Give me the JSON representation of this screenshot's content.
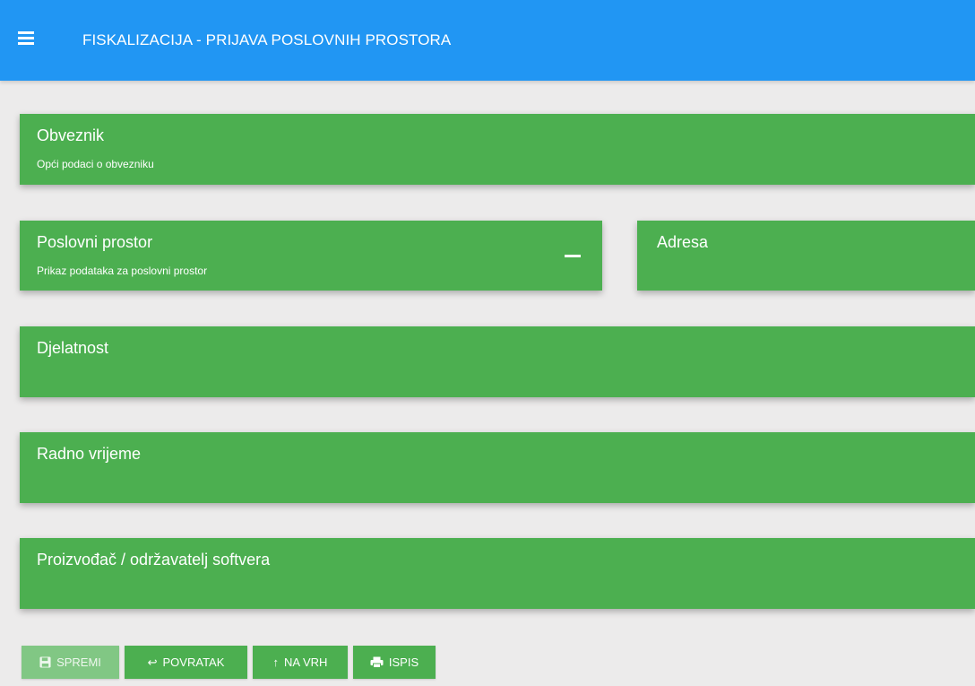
{
  "header": {
    "title": "FISKALIZACIJA - PRIJAVA POSLOVNIH PROSTORA",
    "menu_icon": "hamburger-menu-icon",
    "background_color": "#2196f3"
  },
  "cards": {
    "obveznik": {
      "title": "Obveznik",
      "subtitle": "Opći podaci o obvezniku"
    },
    "poslovni_prostor": {
      "title": "Poslovni prostor",
      "subtitle": "Prikaz podataka za poslovni prostor",
      "collapse_icon": "minus-icon"
    },
    "adresa": {
      "title": "Adresa"
    },
    "djelatnost": {
      "title": "Djelatnost"
    },
    "radno_vrijeme": {
      "title": "Radno vrijeme"
    },
    "proizvodac": {
      "title": "Proizvođač / održavatelj softvera"
    },
    "card_color": "#4caf50"
  },
  "buttons": {
    "save": {
      "label": "SPREMI",
      "icon": "save-icon",
      "disabled": true
    },
    "back": {
      "label": "POVRATAK",
      "icon": "return-arrow-icon"
    },
    "top": {
      "label": "NA VRH",
      "icon": "arrow-up-icon"
    },
    "print": {
      "label": "ISPIS",
      "icon": "print-icon"
    }
  }
}
